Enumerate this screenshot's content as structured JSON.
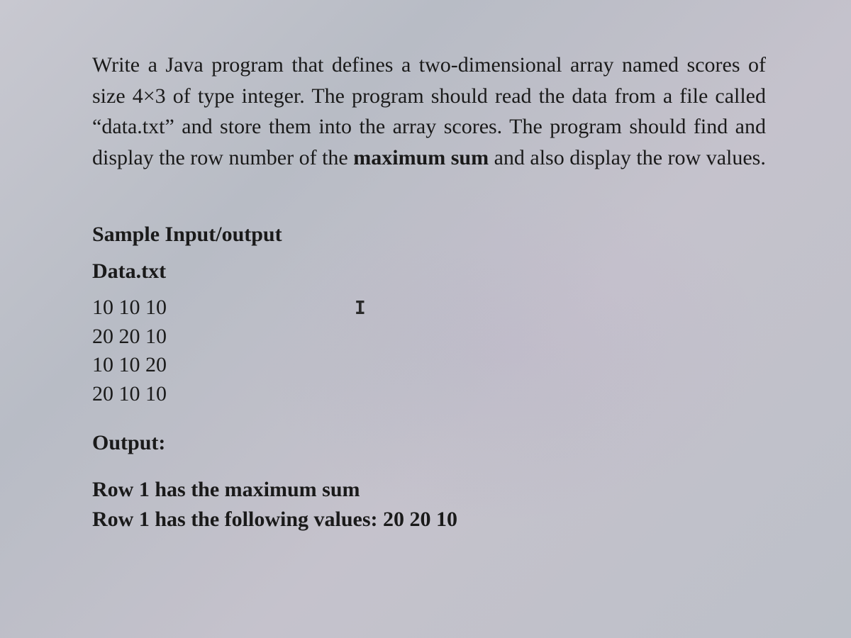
{
  "problem": {
    "text_before_bold": "Write a Java program that defines a two-dimensional array named scores of size 4×3 of type integer. The program should read the data from a file called “data.txt” and store them into the array scores. The program should find and display the row number of the ",
    "bold_phrase": "maximum sum",
    "text_after_bold": " and also display the row values."
  },
  "sample_heading": "Sample Input/output",
  "data_file_label": "Data.txt",
  "data_rows": [
    "10 10 10",
    "20 20 10",
    "10 10 20",
    "20 10 10"
  ],
  "output_label": "Output:",
  "output_lines": [
    "Row 1 has the maximum sum",
    "Row 1 has the following values: 20 20 10"
  ],
  "cursor_glyph": "I"
}
